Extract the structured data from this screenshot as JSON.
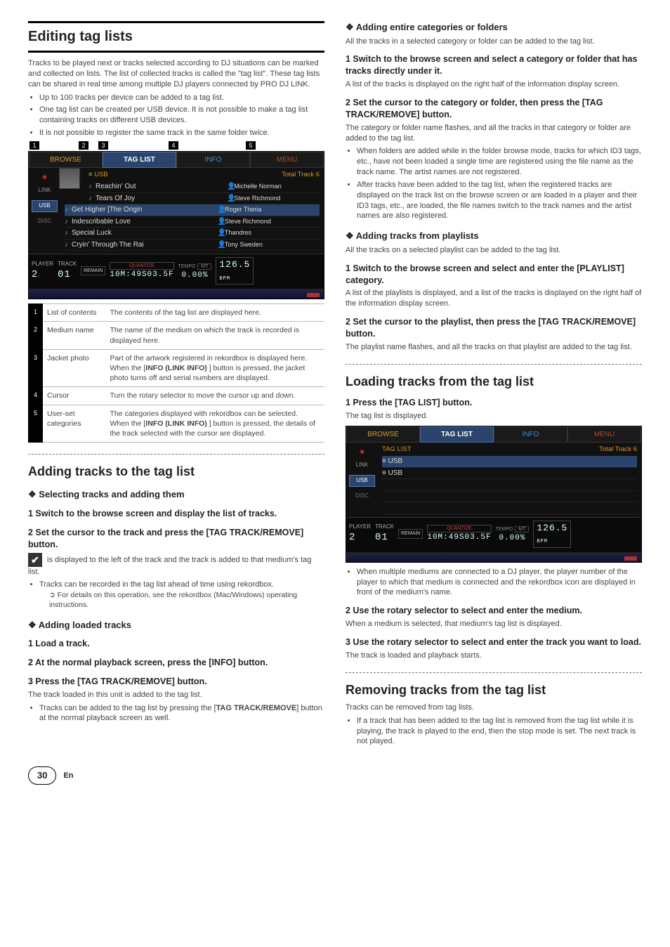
{
  "footer": {
    "page": "30",
    "lang": "En"
  },
  "left": {
    "h1": "Editing tag lists",
    "intro": "Tracks to be played next or tracks selected according to DJ situations can be marked and collected on lists. The list of collected tracks is called the \"tag list\". These tag lists can be shared in real time among multiple DJ players connected by PRO DJ LINK.",
    "introBullets": [
      "Up to 100 tracks per device can be added to a tag list.",
      "One tag list can be created per USB device. It is not possible to make a tag list containing tracks on different USB devices.",
      "It is not possible to register the same track in the same folder twice."
    ],
    "shot1": {
      "tabs": {
        "browse": "BROWSE",
        "taglist": "TAG LIST",
        "info": "INFO",
        "menu": "MENU"
      },
      "side": {
        "link": "LINK",
        "usb": "USB",
        "disc": "DISC"
      },
      "listHeadLeft": "≡ USB",
      "listHeadRight": "Total Track 6",
      "tracks": [
        {
          "title": "Reachin' Out",
          "artist": "Michelle Norman"
        },
        {
          "title": "Tears Of Joy",
          "artist": "Steve Richmond"
        },
        {
          "title": "Get Higher [The Origin",
          "artist": "Roger Theria"
        },
        {
          "title": "Indescribable Love",
          "artist": "Steve Richmond"
        },
        {
          "title": "Special Luck",
          "artist": "Thandres"
        },
        {
          "title": "Cryin' Through The Rai",
          "artist": "Tony Sweden"
        }
      ],
      "player": "PLAYER",
      "playerNum": "2",
      "trackLbl": "TRACK",
      "trackNum": "01",
      "remainLbl": "REMAIN",
      "quant": "QUANTIZE",
      "time": "10M:49S03.5F",
      "tempoLbl": "TEMPO",
      "mt": "MT",
      "tempo": "0.00%",
      "bpm": "126.5",
      "bpmLbl": "BPM"
    },
    "table": {
      "r1": {
        "name": "List of contents",
        "desc": "The contents of the tag list are displayed here."
      },
      "r2": {
        "name": "Medium name",
        "desc": "The name of the medium on which the track is recorded is displayed here."
      },
      "r3a": "Part of the artwork registered in rekordbox is displayed here.",
      "r3b_pre": "When the [",
      "r3b_bold": "INFO (LINK INFO)",
      "r3b_post": " ] button is pressed, the jacket photo turns off and serial numbers are displayed.",
      "r3name": "Jacket photo",
      "r4": {
        "name": "Cursor",
        "desc": "Turn the rotary selector to move the cursor up and down."
      },
      "r5a": "The categories displayed with rekordbox can be selected.",
      "r5b_pre": "When the [",
      "r5b_bold": "INFO (LINK INFO)",
      "r5b_post": " ] button is pressed, the details of the track selected with the cursor are displayed.",
      "r5name": "User-set categories"
    },
    "h2a": "Adding tracks to the tag list",
    "h3a": "Selecting tracks and adding them",
    "step1a": "1   Switch to the browse screen and display the list of tracks.",
    "step2a": "2   Set the cursor to the track and press the [TAG TRACK/REMOVE] button.",
    "checkText": " is displayed to the left of the track and the track is added to that medium's tag list.",
    "checkBullet": "Tracks can be recorded in the tag list ahead of time using rekordbox.",
    "checkSub": "For details on this operation, see the rekordbox (Mac/Windows) operating instructions.",
    "h3b": "Adding loaded tracks",
    "step1b": "1   Load a track.",
    "step2b": "2   At the normal playback screen, press the [INFO] button.",
    "step3b": "3   Press the [TAG TRACK/REMOVE] button.",
    "p3b": "The track loaded in this unit is added to the tag list.",
    "bullet3b_pre": "Tracks can be added to the tag list by pressing the [",
    "bullet3b_bold": "TAG TRACK/REMOVE",
    "bullet3b_post": "] button at the normal playback screen as well."
  },
  "right": {
    "h3a": "Adding entire categories or folders",
    "p1": "All the tracks in a selected category or folder can be added to the tag list.",
    "step1": "1   Switch to the browse screen and select a category or folder that has tracks directly under it.",
    "p2": "A list of the tracks is displayed on the right half of the information display screen.",
    "step2": "2   Set the cursor to the category or folder, then press the [TAG TRACK/REMOVE] button.",
    "p3": "The category or folder name flashes, and all the tracks in that category or folder are added to the tag list.",
    "bullets1": [
      "When folders are added while in the folder browse mode, tracks for which ID3 tags, etc., have not been loaded a single time are registered using the file name as the track name. The artist names are not registered.",
      "After tracks have been added to the tag list, when the registered tracks are displayed on the track list on the browse screen or are loaded in a player and their ID3 tags, etc., are loaded, the file names switch to the track names and the artist names are also registered."
    ],
    "h3b": "Adding tracks from playlists",
    "p4": "All the tracks on a selected playlist can be added to the tag list.",
    "step3": "1   Switch to the browse screen and select and enter the [PLAYLIST] category.",
    "p5": "A list of the playlists is displayed, and a list of the tracks is displayed on the right half of the information display screen.",
    "step4": "2   Set the cursor to the playlist, then press the [TAG TRACK/REMOVE] button.",
    "p6": "The playlist name flashes, and all the tracks on that playlist are added to the tag list.",
    "h2a": "Loading tracks from the tag list",
    "stepL1": "1   Press the [TAG LIST] button.",
    "pL1": "The tag list is displayed.",
    "shot2": {
      "listHeadLeft": "TAG LIST",
      "listHeadRight": "Total Track 6",
      "row1": "≡ USB",
      "row2": "≡ USB"
    },
    "bulletL1": "When multiple mediums are connected to a DJ player, the player number of the player to which that medium is connected and the rekordbox icon are displayed in front of the medium's name.",
    "stepL2": "2   Use the rotary selector to select and enter the medium.",
    "pL2": "When a medium is selected, that medium's tag list is displayed.",
    "stepL3": "3   Use the rotary selector to select and enter the track you want to load.",
    "pL3": "The track is loaded and playback starts.",
    "h2b": "Removing tracks from the tag list",
    "pR1": "Tracks can be removed from tag lists.",
    "bulletR1": "If a track that has been added to the tag list is removed from the tag list while it is playing, the track is played to the end, then the stop mode is set. The next track is not played."
  }
}
